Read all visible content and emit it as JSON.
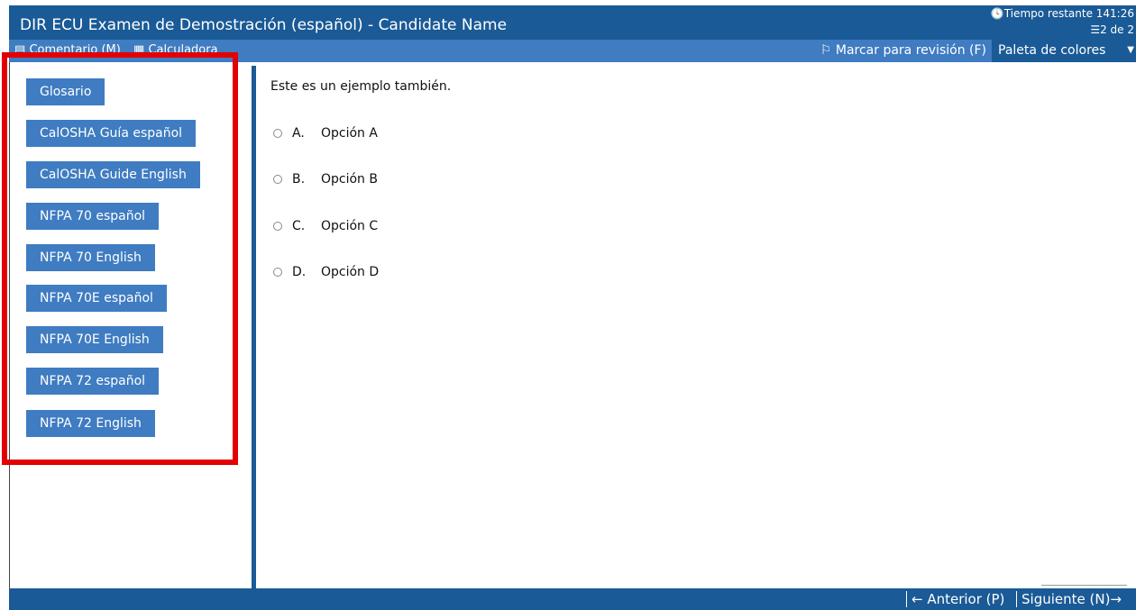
{
  "window": {
    "title": "DIR ECU Examen de Demostración (español) - Candidate Name",
    "timer": "Tiempo restante 141:26",
    "progress": "2 de 2"
  },
  "toolbar": {
    "comment": "Comentario (M)",
    "calculator": "Calculadora",
    "mark_review": "Marcar para revisión (F)",
    "palette": "Paleta de colores"
  },
  "references": [
    "Glosario",
    "CalOSHA Guía español",
    "CalOSHA Guide English",
    "NFPA 70 español",
    "NFPA 70 English",
    "NFPA 70E español",
    "NFPA 70E English",
    "NFPA 72 español",
    "NFPA 72 English"
  ],
  "question": {
    "text": "Este es un ejemplo también.",
    "options": [
      {
        "letter": "A.",
        "text": "Opción A"
      },
      {
        "letter": "B.",
        "text": "Opción B"
      },
      {
        "letter": "C.",
        "text": "Opción C"
      },
      {
        "letter": "D.",
        "text": "Opción D"
      }
    ]
  },
  "footer": {
    "previous": "← Anterior (P)",
    "next": "Siguiente (N)→"
  },
  "colors": {
    "title_bar": "#1a5a96",
    "toolbar": "#3f7cc1",
    "highlight": "#e30000"
  }
}
